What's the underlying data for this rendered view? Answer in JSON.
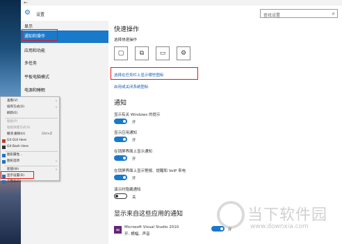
{
  "window": {
    "title": "设置",
    "back_icon": "←",
    "gear_icon": "⚙"
  },
  "search": {
    "placeholder": "查找设置",
    "icon": "⌕"
  },
  "nav": {
    "items": [
      {
        "label": "显示"
      },
      {
        "label": "通知和操作"
      },
      {
        "label": "应用和功能"
      },
      {
        "label": "多任务"
      },
      {
        "label": "平板电脑模式"
      },
      {
        "label": "电源和睡眠"
      }
    ]
  },
  "main": {
    "quick_actions_title": "快速操作",
    "quick_actions_desc": "选择快速操作",
    "quick_action_icons": [
      "▢",
      "⧉",
      "▭",
      "⚙"
    ],
    "link_taskbar_icons": "选择在任务栏上显示哪些图标",
    "link_system_icons": "启用或关闭系统图标",
    "notifications_title": "通知",
    "settings": [
      {
        "label": "显示有关 Windows 的提示",
        "state": "开",
        "on": true
      },
      {
        "label": "显示应用通知",
        "state": "开",
        "on": true
      },
      {
        "label": "在锁屏界面上显示通知",
        "state": "开",
        "on": true
      },
      {
        "label": "在锁屏界面上显示警报、提醒和 VoIP 来电",
        "state": "开",
        "on": true
      },
      {
        "label": "演示时隐藏通知",
        "state": "关",
        "on": false
      }
    ],
    "apps_title": "显示来自这些应用的通知",
    "app": {
      "name": "Microsoft Visual Studio 2010",
      "sub": "开: 横幅、声音",
      "state": "开"
    }
  },
  "context_menu": {
    "items": [
      {
        "label": "查看(V)",
        "arrow": "›",
        "disabled": false
      },
      {
        "label": "排序方式(O)",
        "arrow": "›",
        "disabled": false
      },
      {
        "label": "刷新(E)",
        "disabled": false
      },
      {
        "label": "粘贴(P)",
        "disabled": true
      },
      {
        "label": "粘贴快捷方式(S)",
        "disabled": true
      },
      {
        "label": "撤消 删除(U)",
        "shortcut": "Ctrl+Z",
        "disabled": false
      },
      {
        "label": "Git GUI Here",
        "disabled": false
      },
      {
        "label": "Git Bash Here",
        "disabled": false
      },
      {
        "label": "图形属性...",
        "disabled": false
      },
      {
        "label": "图形选项",
        "arrow": "›",
        "disabled": false
      },
      {
        "label": "新建(W)",
        "arrow": "›",
        "disabled": false
      },
      {
        "label": "显示设置(D)",
        "disabled": false
      },
      {
        "label": "个性化(R)",
        "disabled": false
      }
    ]
  },
  "watermark": {
    "text": "当下软件园",
    "url": "www.downxia.com"
  },
  "colors": {
    "accent": "#1979ca",
    "highlight_box": "#e11111",
    "link": "#1a5fb4"
  }
}
